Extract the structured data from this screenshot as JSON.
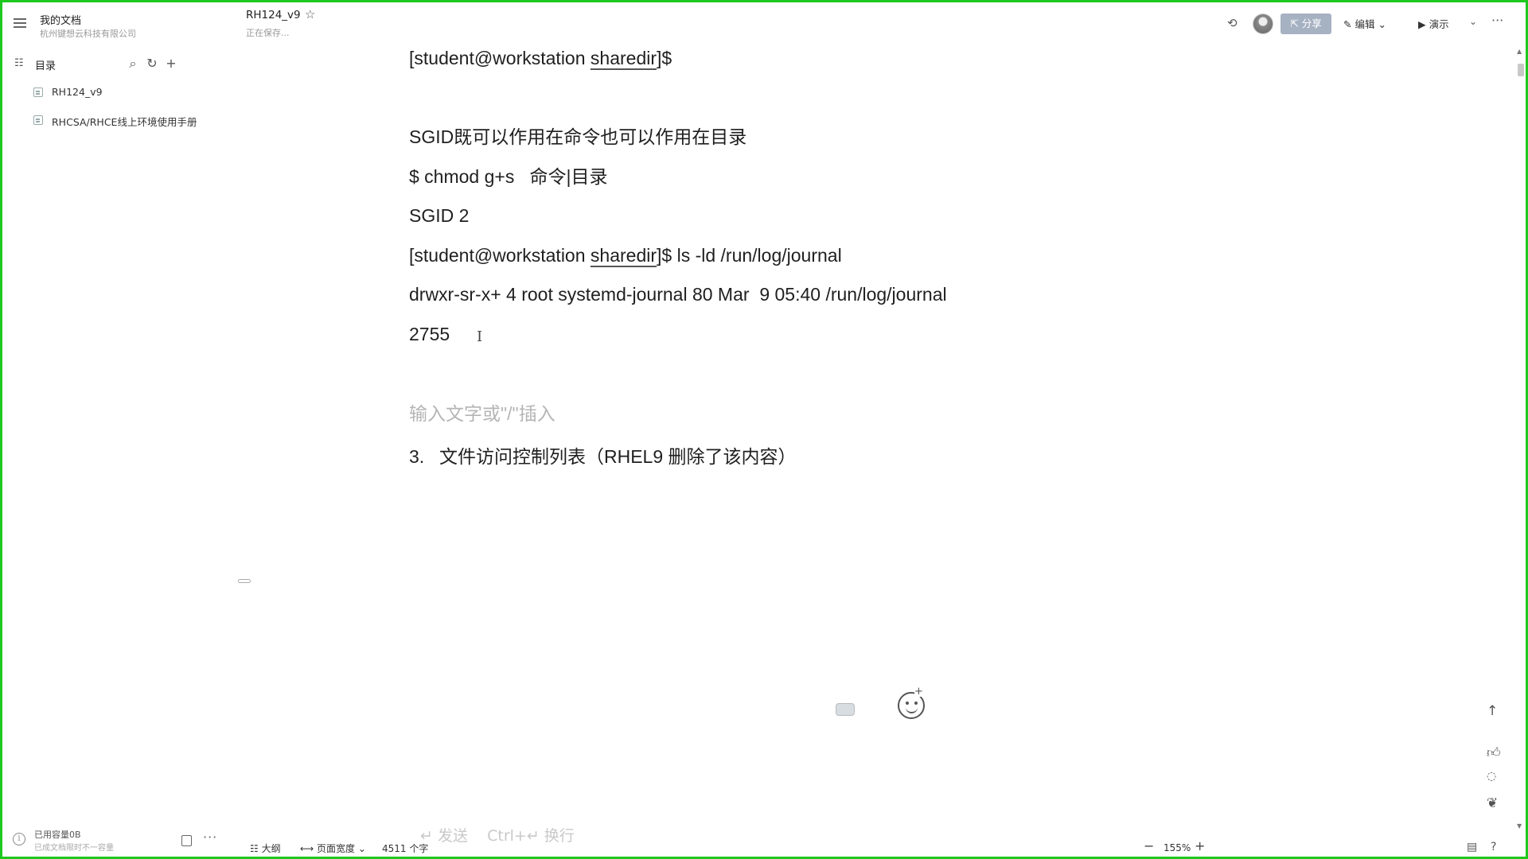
{
  "sidebar": {
    "title": "我的文档",
    "subtitle": "杭州键想云科技有限公司",
    "toc_label": "目录",
    "items": [
      {
        "label": "RH124_v9"
      },
      {
        "label": "RHCSA/RHCE线上环境使用手册"
      }
    ],
    "usage_label": "已用容量0B",
    "usage_sub": "已成文档限时不一容量"
  },
  "header": {
    "doc_title": "RH124_v9",
    "save_status": "正在保存...",
    "share_label": "分享",
    "edit_label": "编辑",
    "present_label": "演示"
  },
  "content": {
    "line1_prefix": "[student@workstation ",
    "line1_dir": "sharedir",
    "line1_suffix": "]$",
    "line2": "SGID既可以作用在命令也可以作用在目录",
    "line3": "$ chmod g+s   命令|目录",
    "line4": "SGID 2",
    "line5_prefix": "[student@workstation ",
    "line5_dir": "sharedir",
    "line5_suffix": "]$ ls -ld /run/log/journal",
    "line6": "drwxr-sr-x+ 4 root systemd-journal 80 Mar  9 05:40 /run/log/journal",
    "line7": "2755",
    "placeholder": "输入文字或\"/\"插入",
    "list_num": "3.",
    "list_text": "文件访问控制列表（RHEL9 删除了该内容）",
    "ghost_hint": "↵ 发送    Ctrl+↵ 换行"
  },
  "status_bar": {
    "outline_label": "大纲",
    "page_width_label": "页面宽度",
    "word_count": "4511 个字",
    "zoom": "155%"
  },
  "icons": {
    "menu": "hamburger-icon",
    "toc": "list-tree-icon",
    "search": "search-icon",
    "refresh": "refresh-icon",
    "add": "plus-icon",
    "star": "star-icon",
    "share": "share-external-icon",
    "edit": "pencil-icon",
    "present": "play-icon",
    "more": "ellipsis-icon"
  }
}
